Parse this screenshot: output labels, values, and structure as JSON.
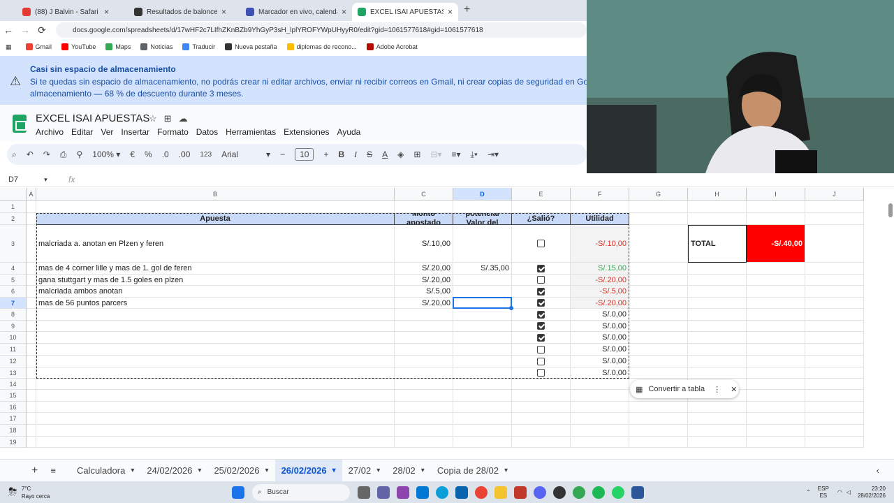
{
  "browser": {
    "tabs": [
      {
        "title": "(88) J Balvin - Safari ft. Phar",
        "color": "#e53935"
      },
      {
        "title": "Resultados de baloncesto en vi",
        "color": "#333333"
      },
      {
        "title": "Marcador en vivo, calendario y",
        "color": "#3f51b5"
      },
      {
        "title": "EXCEL ISAI APUESTAS - Hojas d",
        "color": "#1fa463"
      }
    ],
    "new_tab": "+",
    "url": "docs.google.com/spreadsheets/d/17wHF2c7LIfhZKnBZb9YhGyP3sH_lplYROFYWpUHyyR0/edit?gid=1061577618#gid=1061577618",
    "bookmarks": [
      "Gmail",
      "YouTube",
      "Maps",
      "Noticias",
      "Traducir",
      "Nueva pestaña",
      "diplomas de recono...",
      "Adobe Acrobat"
    ]
  },
  "banner": {
    "title": "Casi sin espacio de almacenamiento",
    "line1": "Si te quedas sin espacio de almacenamiento, no podrás crear ni editar archivos, enviar ni recibir correos en Gmail, ni crear copias de seguridad en Goo",
    "line2": "almacenamiento — 68 % de descuento durante 3 meses."
  },
  "doc": {
    "title": "EXCEL ISAI APUESTAS",
    "menus": [
      "Archivo",
      "Editar",
      "Ver",
      "Insertar",
      "Formato",
      "Datos",
      "Herramientas",
      "Extensiones",
      "Ayuda"
    ]
  },
  "toolbar": {
    "zoom": "100%",
    "currency": "€",
    "percent": "%",
    "dec_less": ".0",
    "dec_more": ".00",
    "format": "123",
    "font": "Arial",
    "font_size": "10"
  },
  "formula_bar": {
    "cell_ref": "D7",
    "fx": "fx",
    "value": ""
  },
  "columns": [
    "A",
    "B",
    "C",
    "D",
    "E",
    "F",
    "G",
    "H",
    "I",
    "J"
  ],
  "rows": [
    "1",
    "2",
    "3",
    "4",
    "5",
    "6",
    "7",
    "8",
    "9",
    "10",
    "11",
    "12",
    "13",
    "14",
    "15",
    "16",
    "17",
    "18",
    "19"
  ],
  "table": {
    "headers": {
      "apuesta": "Apuesta",
      "monto": "Monto apostado",
      "ganancia": "Ganancia potencial Valor del cashout",
      "salio": "¿Salió?",
      "utilidad": "Utilidad"
    },
    "rows": [
      {
        "apuesta": "malcriada a. anotan en Plzen y feren",
        "monto": "S/.10,00",
        "ganancia": "",
        "checked": false,
        "utilidad": "-S/.10,00",
        "sign": "neg"
      },
      {
        "apuesta": "mas de 4 corner lille y mas de 1. gol de feren",
        "monto": "S/.20,00",
        "ganancia": "S/.35,00",
        "checked": true,
        "utilidad": "S/.15,00",
        "sign": "pos"
      },
      {
        "apuesta": "gana stuttgart y mas de 1.5 goles en plzen",
        "monto": "S/.20,00",
        "ganancia": "",
        "checked": false,
        "utilidad": "-S/.20,00",
        "sign": "neg"
      },
      {
        "apuesta": "malcriada ambos anotan",
        "monto": "S/.5,00",
        "ganancia": "",
        "checked": true,
        "utilidad": "-S/.5,00",
        "sign": "neg"
      },
      {
        "apuesta": "mas de 56 puntos parcers",
        "monto": "S/.20,00",
        "ganancia": "",
        "checked": true,
        "utilidad": "-S/.20,00",
        "sign": "neg"
      },
      {
        "apuesta": "",
        "monto": "",
        "ganancia": "",
        "checked": true,
        "utilidad": "S/.0,00",
        "sign": "zero"
      },
      {
        "apuesta": "",
        "monto": "",
        "ganancia": "",
        "checked": true,
        "utilidad": "S/.0,00",
        "sign": "zero"
      },
      {
        "apuesta": "",
        "monto": "",
        "ganancia": "",
        "checked": true,
        "utilidad": "S/.0,00",
        "sign": "zero"
      },
      {
        "apuesta": "",
        "monto": "",
        "ganancia": "",
        "checked": false,
        "utilidad": "S/.0,00",
        "sign": "zero"
      },
      {
        "apuesta": "",
        "monto": "",
        "ganancia": "",
        "checked": false,
        "utilidad": "S/.0,00",
        "sign": "zero"
      },
      {
        "apuesta": "",
        "monto": "",
        "ganancia": "",
        "checked": false,
        "utilidad": "S/.0,00",
        "sign": "zero"
      }
    ]
  },
  "total": {
    "label": "TOTAL",
    "value": "-S/.40,00",
    "color": "#ff0000"
  },
  "convert_chip": {
    "label": "Convertir a tabla"
  },
  "sheet_tabs": {
    "items": [
      "Calculadora",
      "24/02/2026",
      "25/02/2026",
      "26/02/2026",
      "27/02",
      "28/02",
      "Copia de 28/02"
    ],
    "active": "26/02/2026"
  },
  "taskbar": {
    "weather_temp": "7°C",
    "weather_desc": "Rayo cerca",
    "search_placeholder": "Buscar",
    "lang": "ESP",
    "lang2": "ES",
    "time": "23:20",
    "date": "28/02/2026"
  }
}
